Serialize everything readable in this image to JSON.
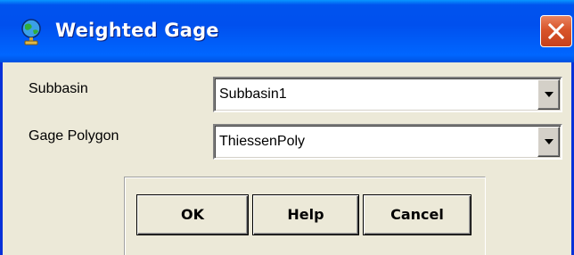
{
  "window": {
    "title": "Weighted Gage"
  },
  "fields": {
    "subbasin": {
      "label": "Subbasin",
      "value": "Subbasin1"
    },
    "gage_polygon": {
      "label": "Gage Polygon",
      "value": "ThiessenPoly"
    }
  },
  "buttons": {
    "ok": "OK",
    "help": "Help",
    "cancel": "Cancel"
  },
  "colors": {
    "titlebar": "#0055ea",
    "close_button": "#d8542a",
    "dialog_background": "#ece9d8"
  },
  "icons": {
    "title": "globe-icon",
    "close": "close-icon",
    "dropdown": "chevron-down-icon"
  }
}
